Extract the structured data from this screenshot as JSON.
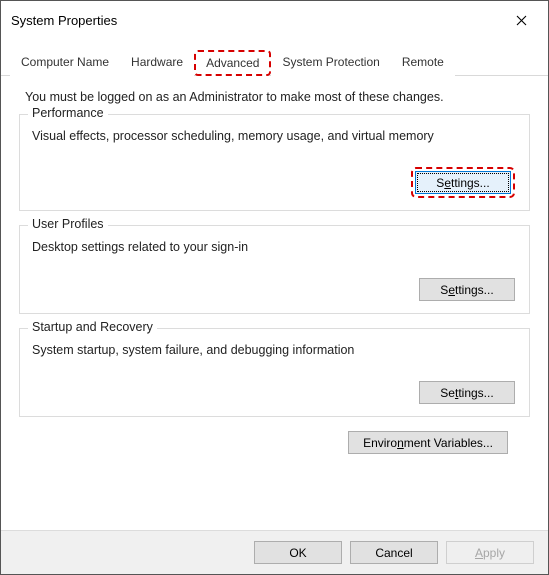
{
  "window": {
    "title": "System Properties"
  },
  "tabs": {
    "computer_name": "Computer Name",
    "hardware": "Hardware",
    "advanced": "Advanced",
    "system_protection": "System Protection",
    "remote": "Remote"
  },
  "intro": "You must be logged on as an Administrator to make most of these changes.",
  "groups": {
    "performance": {
      "label": "Performance",
      "desc": "Visual effects, processor scheduling, memory usage, and virtual memory",
      "button": "Settings..."
    },
    "user_profiles": {
      "label": "User Profiles",
      "desc": "Desktop settings related to your sign-in",
      "button": "Settings..."
    },
    "startup_recovery": {
      "label": "Startup and Recovery",
      "desc": "System startup, system failure, and debugging information",
      "button": "Settings..."
    }
  },
  "env_button": "Environment Variables...",
  "footer": {
    "ok": "OK",
    "cancel": "Cancel",
    "apply": "Apply"
  }
}
